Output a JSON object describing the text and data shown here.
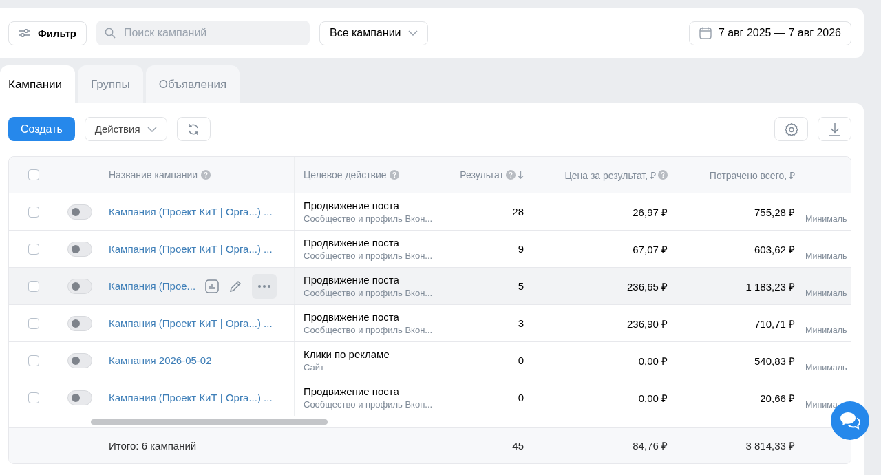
{
  "filter_bar": {
    "filter_button": "Фильтр",
    "search": {
      "placeholder": "Поиск кампаний"
    },
    "scope_dropdown": "Все кампании",
    "date_range": "7 авг 2025 — 7 авг 2026"
  },
  "tabs": [
    {
      "label": "Кампании",
      "selected": true
    },
    {
      "label": "Группы",
      "selected": false
    },
    {
      "label": "Объявления",
      "selected": false
    }
  ],
  "toolbar": {
    "create_button": "Создать",
    "actions_dropdown": "Действия"
  },
  "table": {
    "select_all_checked": false,
    "columns": [
      {
        "label": "Название кампании",
        "help": true,
        "sorted": false
      },
      {
        "label": "Целевое действие",
        "help": true,
        "sorted": false
      },
      {
        "label": "Результат",
        "help": true,
        "sorted": true
      },
      {
        "label": "Цена за результат, ₽",
        "help": true,
        "sorted": false
      },
      {
        "label": "Потрачено всего, ₽",
        "help": false,
        "sorted": false
      }
    ],
    "rows": [
      {
        "checked": false,
        "on": false,
        "hovered": false,
        "name": "Кампания (Проект КиТ | Орга...) ...",
        "target": "Продвижение поста",
        "target_detail": "Сообщество и профиль Вкон...",
        "result": "28",
        "price": "26,97 ₽",
        "spent": "755,28 ₽",
        "column_8": "Минималь"
      },
      {
        "checked": false,
        "on": false,
        "hovered": false,
        "name": "Кампания (Проект КиТ | Орга...) ...",
        "target": "Продвижение поста",
        "target_detail": "Сообщество и профиль Вкон...",
        "result": "9",
        "price": "67,07 ₽",
        "spent": "603,62 ₽",
        "column_8": "Минималь"
      },
      {
        "checked": false,
        "on": false,
        "hovered": true,
        "name": "Кампания (Прое...",
        "target": "Продвижение поста",
        "target_detail": "Сообщество и профиль Вкон...",
        "result": "5",
        "price": "236,65 ₽",
        "spent": "1 183,23 ₽",
        "column_8": "Минималь"
      },
      {
        "checked": false,
        "on": false,
        "hovered": false,
        "name": "Кампания (Проект КиТ | Орга...) ...",
        "target": "Продвижение поста",
        "target_detail": "Сообщество и профиль Вкон...",
        "result": "3",
        "price": "236,90 ₽",
        "spent": "710,71 ₽",
        "column_8": "Минималь"
      },
      {
        "checked": false,
        "on": false,
        "hovered": false,
        "name": "Кампания 2026-05-02",
        "target": "Клики по рекламе",
        "target_detail": "Сайт",
        "result": "0",
        "price": "0,00 ₽",
        "spent": "540,83 ₽",
        "column_8": "Минималь"
      },
      {
        "checked": false,
        "on": false,
        "hovered": false,
        "name": "Кампания (Проект КиТ | Орга...) ...",
        "target": "Продвижение поста",
        "target_detail": "Сообщество и профиль Вкон...",
        "result": "0",
        "price": "0,00 ₽",
        "spent": "20,66 ₽",
        "column_8": "Минима"
      }
    ],
    "footer": {
      "label": "Итого: 6 кампаний",
      "result": "45",
      "price": "84,76 ₽",
      "spent": "3 814,33 ₽"
    }
  }
}
